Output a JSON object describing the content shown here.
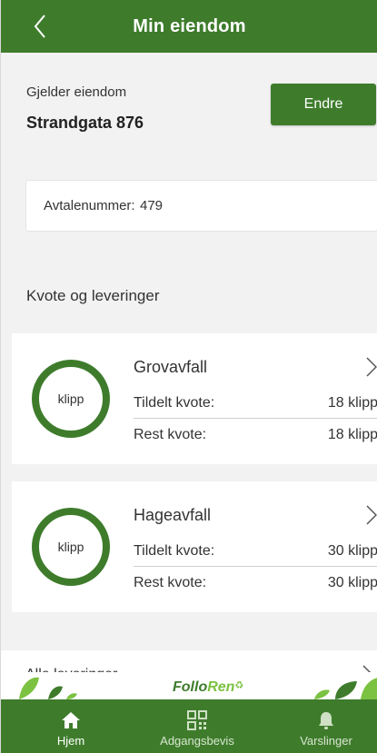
{
  "header": {
    "title": "Min eiendom"
  },
  "property": {
    "label": "Gjelder eiendom",
    "address": "Strandgata 876",
    "change_button": "Endre"
  },
  "agreement": {
    "label": "Avtalenummer:",
    "number": "479"
  },
  "section": {
    "title": "Kvote og leveringer"
  },
  "quotas": [
    {
      "name": "Grovavfall",
      "ring_label": "klipp",
      "allocated_label": "Tildelt kvote:",
      "allocated_value": "18 klipp",
      "remaining_label": "Rest kvote:",
      "remaining_value": "18 klipp"
    },
    {
      "name": "Hageavfall",
      "ring_label": "klipp",
      "allocated_label": "Tildelt kvote:",
      "allocated_value": "30 klipp",
      "remaining_label": "Rest kvote:",
      "remaining_value": "30 klipp"
    }
  ],
  "all_deliveries": {
    "label": "Alle leveringer"
  },
  "brand": {
    "name_part1": "Follo",
    "name_part2": "Ren"
  },
  "tabbar": {
    "items": [
      {
        "label": "Hjem",
        "icon": "home-icon",
        "active": true
      },
      {
        "label": "Adgangsbevis",
        "icon": "qr-code-icon",
        "active": false
      },
      {
        "label": "Varslinger",
        "icon": "bell-icon",
        "active": false
      }
    ]
  },
  "colors": {
    "primary": "#3e7c2c",
    "accent": "#7cc242",
    "background": "#f2f2f2"
  }
}
